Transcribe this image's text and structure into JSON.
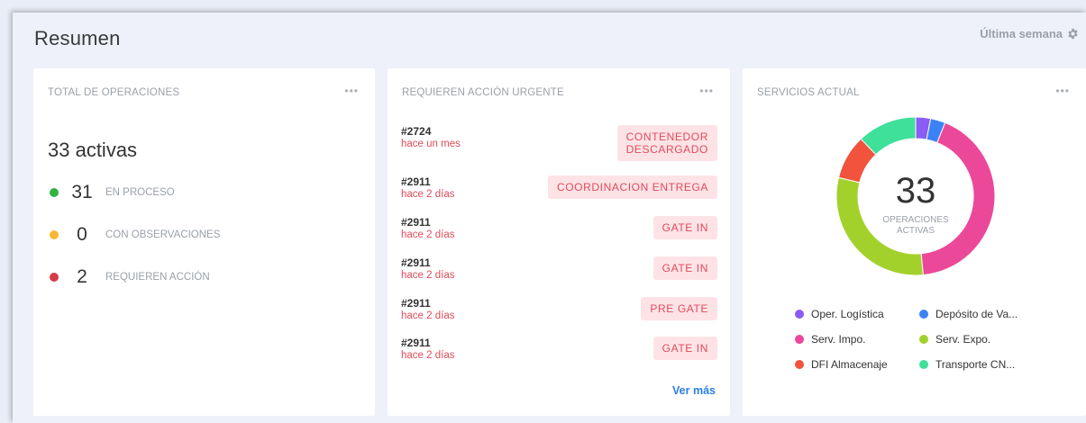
{
  "header": {
    "title": "Resumen",
    "period_label": "Última semana"
  },
  "total_card": {
    "title": "TOTAL DE OPERACIONES",
    "menu": "•••",
    "active_label": "33 activas",
    "stats": [
      {
        "value": "31",
        "label": "EN PROCESO",
        "color": "#2fb344"
      },
      {
        "value": "0",
        "label": "CON OBSERVACIONES",
        "color": "#f9b731"
      },
      {
        "value": "2",
        "label": "REQUIEREN ACCIÓN",
        "color": "#d83a48"
      }
    ]
  },
  "urgent_card": {
    "title": "REQUIEREN ACCIÓN URGENTE",
    "menu": "•••",
    "items": [
      {
        "id": "#2724",
        "time": "hace un mes",
        "tag_line1": "CONTENEDOR",
        "tag_line2": "DESCARGADO"
      },
      {
        "id": "#2911",
        "time": "hace 2 días",
        "tag_line1": "COORDINACION ENTREGA",
        "tag_line2": ""
      },
      {
        "id": "#2911",
        "time": "hace 2 días",
        "tag_line1": "GATE IN",
        "tag_line2": ""
      },
      {
        "id": "#2911",
        "time": "hace 2 días",
        "tag_line1": "GATE IN",
        "tag_line2": ""
      },
      {
        "id": "#2911",
        "time": "hace 2 días",
        "tag_line1": "PRE GATE",
        "tag_line2": ""
      },
      {
        "id": "#2911",
        "time": "hace 2 días",
        "tag_line1": "GATE IN",
        "tag_line2": ""
      }
    ],
    "see_more": "Ver más"
  },
  "services_card": {
    "title": "SERVICIOS ACTUAL",
    "menu": "•••",
    "center_value": "33",
    "center_label_line1": "OPERACIONES",
    "center_label_line2": "ACTIVAS",
    "legend": [
      {
        "label": "Oper. Logística",
        "color": "#8b5cf6"
      },
      {
        "label": "Depósito de Va...",
        "color": "#3b82f6"
      },
      {
        "label": "Serv. Impo.",
        "color": "#ec4899"
      },
      {
        "label": "Serv. Expo.",
        "color": "#a3d12c"
      },
      {
        "label": "DFI Almacenaje",
        "color": "#f1533c"
      },
      {
        "label": "Transporte CN...",
        "color": "#3ee09a"
      }
    ]
  },
  "chart_data": {
    "type": "pie",
    "title": "",
    "categories": [
      "Oper. Logística",
      "Depósito de Va...",
      "Serv. Impo.",
      "Serv. Expo.",
      "DFI Almacenaje",
      "Transporte CN..."
    ],
    "values": [
      1,
      1,
      14,
      10,
      3,
      4
    ],
    "colors": [
      "#8b5cf6",
      "#3b82f6",
      "#ec4899",
      "#a3d12c",
      "#f1533c",
      "#3ee09a"
    ],
    "center_text": "33",
    "legend": "bottom"
  }
}
